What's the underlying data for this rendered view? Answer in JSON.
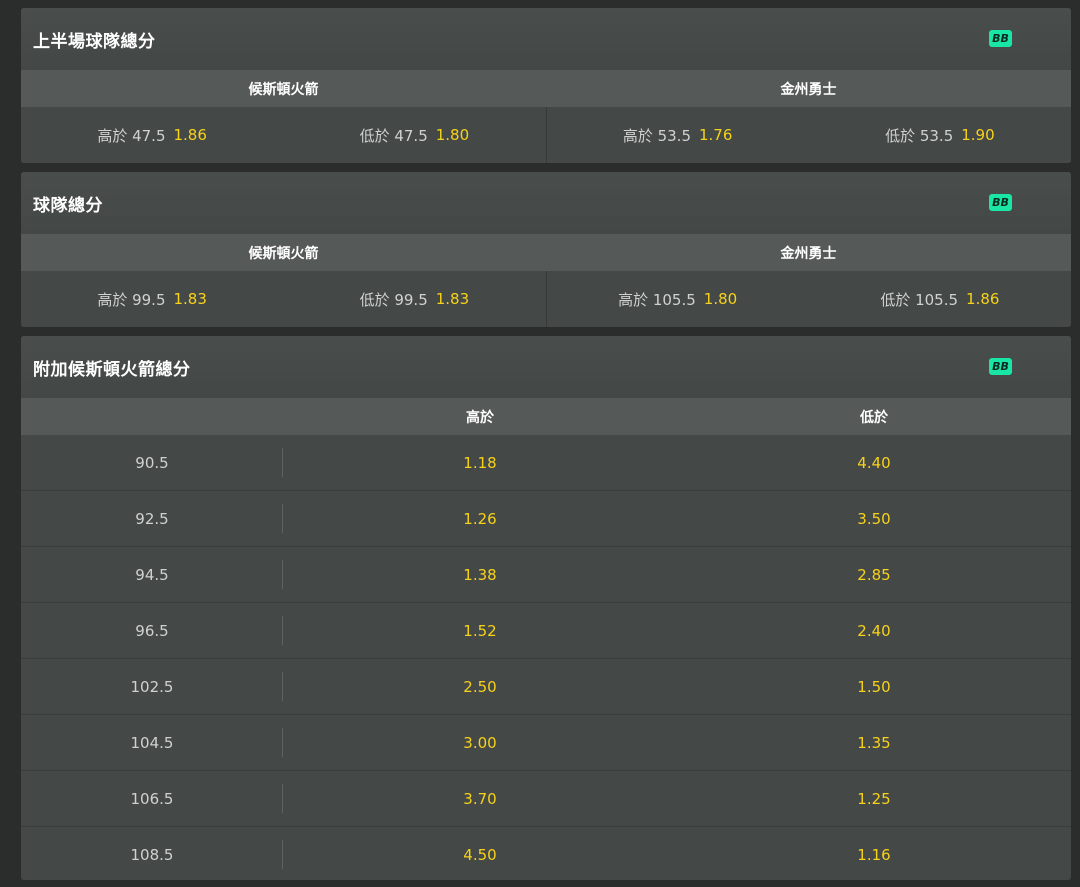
{
  "sections": [
    {
      "title": "上半場球隊總分",
      "badge": "BB",
      "teams": [
        {
          "name": "候斯頓火箭",
          "over": {
            "label": "高於 47.5",
            "price": "1.86"
          },
          "under": {
            "label": "低於 47.5",
            "price": "1.80"
          }
        },
        {
          "name": "金州勇士",
          "over": {
            "label": "高於 53.5",
            "price": "1.76"
          },
          "under": {
            "label": "低於 53.5",
            "price": "1.90"
          }
        }
      ]
    },
    {
      "title": "球隊總分",
      "badge": "BB",
      "teams": [
        {
          "name": "候斯頓火箭",
          "over": {
            "label": "高於 99.5",
            "price": "1.83"
          },
          "under": {
            "label": "低於 99.5",
            "price": "1.83"
          }
        },
        {
          "name": "金州勇士",
          "over": {
            "label": "高於 105.5",
            "price": "1.80"
          },
          "under": {
            "label": "低於 105.5",
            "price": "1.86"
          }
        }
      ]
    }
  ],
  "alt": {
    "title": "附加候斯頓火箭總分",
    "badge": "BB",
    "headers": {
      "line": "",
      "over": "高於",
      "under": "低於"
    },
    "rows": [
      {
        "line": "90.5",
        "over": "1.18",
        "under": "4.40"
      },
      {
        "line": "92.5",
        "over": "1.26",
        "under": "3.50"
      },
      {
        "line": "94.5",
        "over": "1.38",
        "under": "2.85"
      },
      {
        "line": "96.5",
        "over": "1.52",
        "under": "2.40"
      },
      {
        "line": "102.5",
        "over": "2.50",
        "under": "1.50"
      },
      {
        "line": "104.5",
        "over": "3.00",
        "under": "1.35"
      },
      {
        "line": "106.5",
        "over": "3.70",
        "under": "1.25"
      },
      {
        "line": "108.5",
        "over": "4.50",
        "under": "1.16"
      }
    ]
  },
  "colors": {
    "price": "#f7d21a",
    "badge": "#19e6a4",
    "card": "#464a48",
    "background": "#2b2d2c"
  }
}
